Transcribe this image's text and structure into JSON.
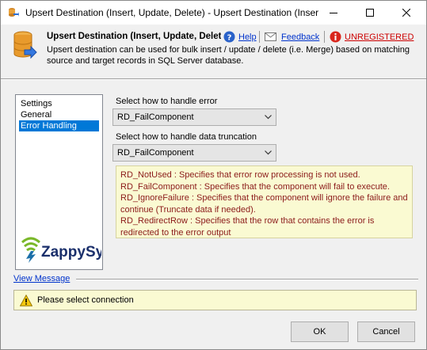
{
  "window": {
    "title": "Upsert Destination (Insert, Update, Delete) - Upsert Destination (Inser..."
  },
  "header": {
    "title": "Upsert Destination (Insert, Update, Delet",
    "help_label": "Help",
    "feedback_label": "Feedback",
    "unregistered_label": "UNREGISTERED",
    "description": "Upsert destination can be used for bulk insert / update / delete (i.e. Merge) based on matching source and target records in SQL Server database."
  },
  "nav": {
    "items": [
      {
        "label": "Settings",
        "selected": false
      },
      {
        "label": "General",
        "selected": false
      },
      {
        "label": "Error Handling",
        "selected": true
      }
    ],
    "logo_text": "ZappySys"
  },
  "error_handling": {
    "error_label": "Select how to handle error",
    "error_value": "RD_FailComponent",
    "truncation_label": "Select how to handle data truncation",
    "truncation_value": "RD_FailComponent",
    "help_lines": [
      "RD_NotUsed : Specifies that error row processing is not used.",
      "RD_FailComponent : Specifies that the component will fail to execute.",
      "RD_IgnoreFailure : Specifies that the component will ignore the failure and",
      "continue (Truncate data if needed).",
      "RD_RedirectRow : Specifies that the row that contains the error is",
      "redirected to the error output"
    ]
  },
  "messages": {
    "view_label": "View Message",
    "text": "Please select connection"
  },
  "buttons": {
    "ok": "OK",
    "cancel": "Cancel"
  },
  "colors": {
    "accent": "#0078d7",
    "link": "#0033cc",
    "unregistered": "#cc0000",
    "info_bg": "#fafad2",
    "info_text": "#8b1a1a"
  }
}
